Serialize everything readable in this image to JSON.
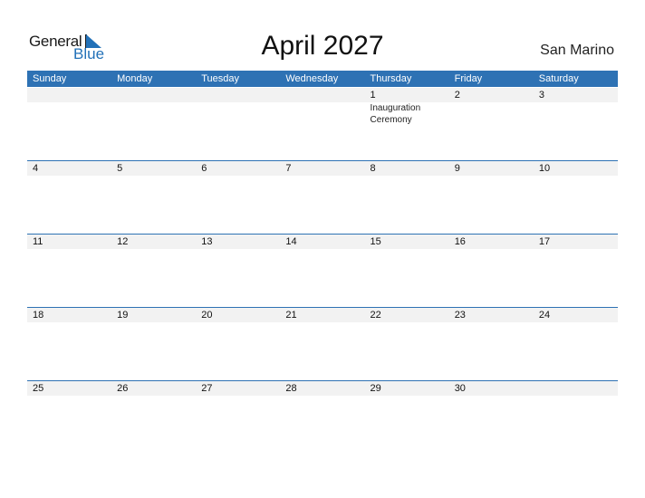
{
  "logo": {
    "general": "General",
    "blue": "Blue",
    "icon": "triangle-flag-icon"
  },
  "title": "April 2027",
  "country": "San Marino",
  "accent_color": "#2e72b4",
  "weekdays": [
    "Sunday",
    "Monday",
    "Tuesday",
    "Wednesday",
    "Thursday",
    "Friday",
    "Saturday"
  ],
  "weeks": [
    [
      {
        "d": ""
      },
      {
        "d": ""
      },
      {
        "d": ""
      },
      {
        "d": ""
      },
      {
        "d": "1",
        "e": "Inauguration Ceremony"
      },
      {
        "d": "2"
      },
      {
        "d": "3"
      }
    ],
    [
      {
        "d": "4"
      },
      {
        "d": "5"
      },
      {
        "d": "6"
      },
      {
        "d": "7"
      },
      {
        "d": "8"
      },
      {
        "d": "9"
      },
      {
        "d": "10"
      }
    ],
    [
      {
        "d": "11"
      },
      {
        "d": "12"
      },
      {
        "d": "13"
      },
      {
        "d": "14"
      },
      {
        "d": "15"
      },
      {
        "d": "16"
      },
      {
        "d": "17"
      }
    ],
    [
      {
        "d": "18"
      },
      {
        "d": "19"
      },
      {
        "d": "20"
      },
      {
        "d": "21"
      },
      {
        "d": "22"
      },
      {
        "d": "23"
      },
      {
        "d": "24"
      }
    ],
    [
      {
        "d": "25"
      },
      {
        "d": "26"
      },
      {
        "d": "27"
      },
      {
        "d": "28"
      },
      {
        "d": "29"
      },
      {
        "d": "30"
      },
      {
        "d": ""
      }
    ]
  ]
}
